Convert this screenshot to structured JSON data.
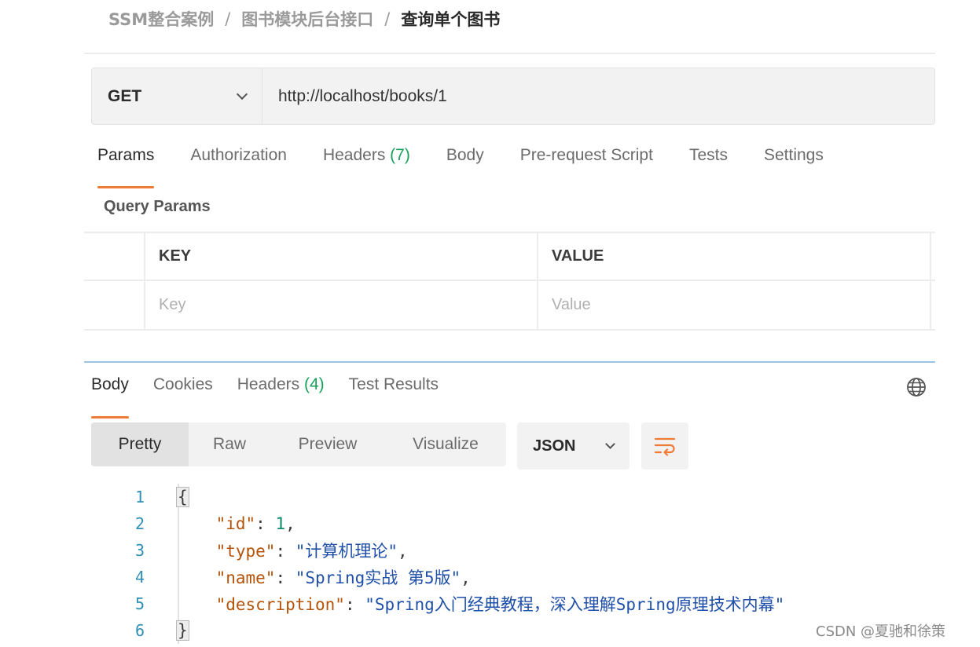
{
  "breadcrumb": {
    "items": [
      "SSM整合案例",
      "图书模块后台接口"
    ],
    "separator": "/",
    "current": "查询单个图书"
  },
  "request": {
    "method": "GET",
    "url": "http://localhost/books/1"
  },
  "request_tabs": [
    {
      "label": "Params",
      "active": true
    },
    {
      "label": "Authorization"
    },
    {
      "label": "Headers",
      "count": "(7)"
    },
    {
      "label": "Body"
    },
    {
      "label": "Pre-request Script"
    },
    {
      "label": "Tests"
    },
    {
      "label": "Settings"
    }
  ],
  "query_params": {
    "title": "Query Params",
    "columns": [
      "KEY",
      "VALUE"
    ],
    "placeholders": {
      "key": "Key",
      "value": "Value"
    }
  },
  "response_tabs": [
    {
      "label": "Body",
      "active": true
    },
    {
      "label": "Cookies"
    },
    {
      "label": "Headers",
      "count": "(4)"
    },
    {
      "label": "Test Results"
    }
  ],
  "response_icons": {
    "globe": "globe-icon",
    "wrap": "wrap-lines-icon"
  },
  "format_options": [
    "Pretty",
    "Raw",
    "Preview",
    "Visualize"
  ],
  "selected_format": "Pretty",
  "language": "JSON",
  "code": {
    "line_numbers": [
      "1",
      "2",
      "3",
      "4",
      "5",
      "6"
    ],
    "open_brace": "{",
    "close_brace": "}",
    "fields": [
      {
        "key": "\"id\"",
        "value": "1",
        "type": "number",
        "trail": ","
      },
      {
        "key": "\"type\"",
        "value": "\"计算机理论\"",
        "type": "string",
        "trail": ","
      },
      {
        "key": "\"name\"",
        "value": "\"Spring实战 第5版\"",
        "type": "string",
        "trail": ","
      },
      {
        "key": "\"description\"",
        "value": "\"Spring入门经典教程，深入理解Spring原理技术内幕\"",
        "type": "string",
        "trail": ""
      }
    ]
  },
  "colors": {
    "accent": "#f07b36",
    "count": "#18a058",
    "json_key": "#b45309",
    "json_string": "#1f4fa8",
    "json_number": "#0b8a6a",
    "line_number": "#2f8fb4"
  },
  "watermark": "CSDN @夏驰和徐策"
}
